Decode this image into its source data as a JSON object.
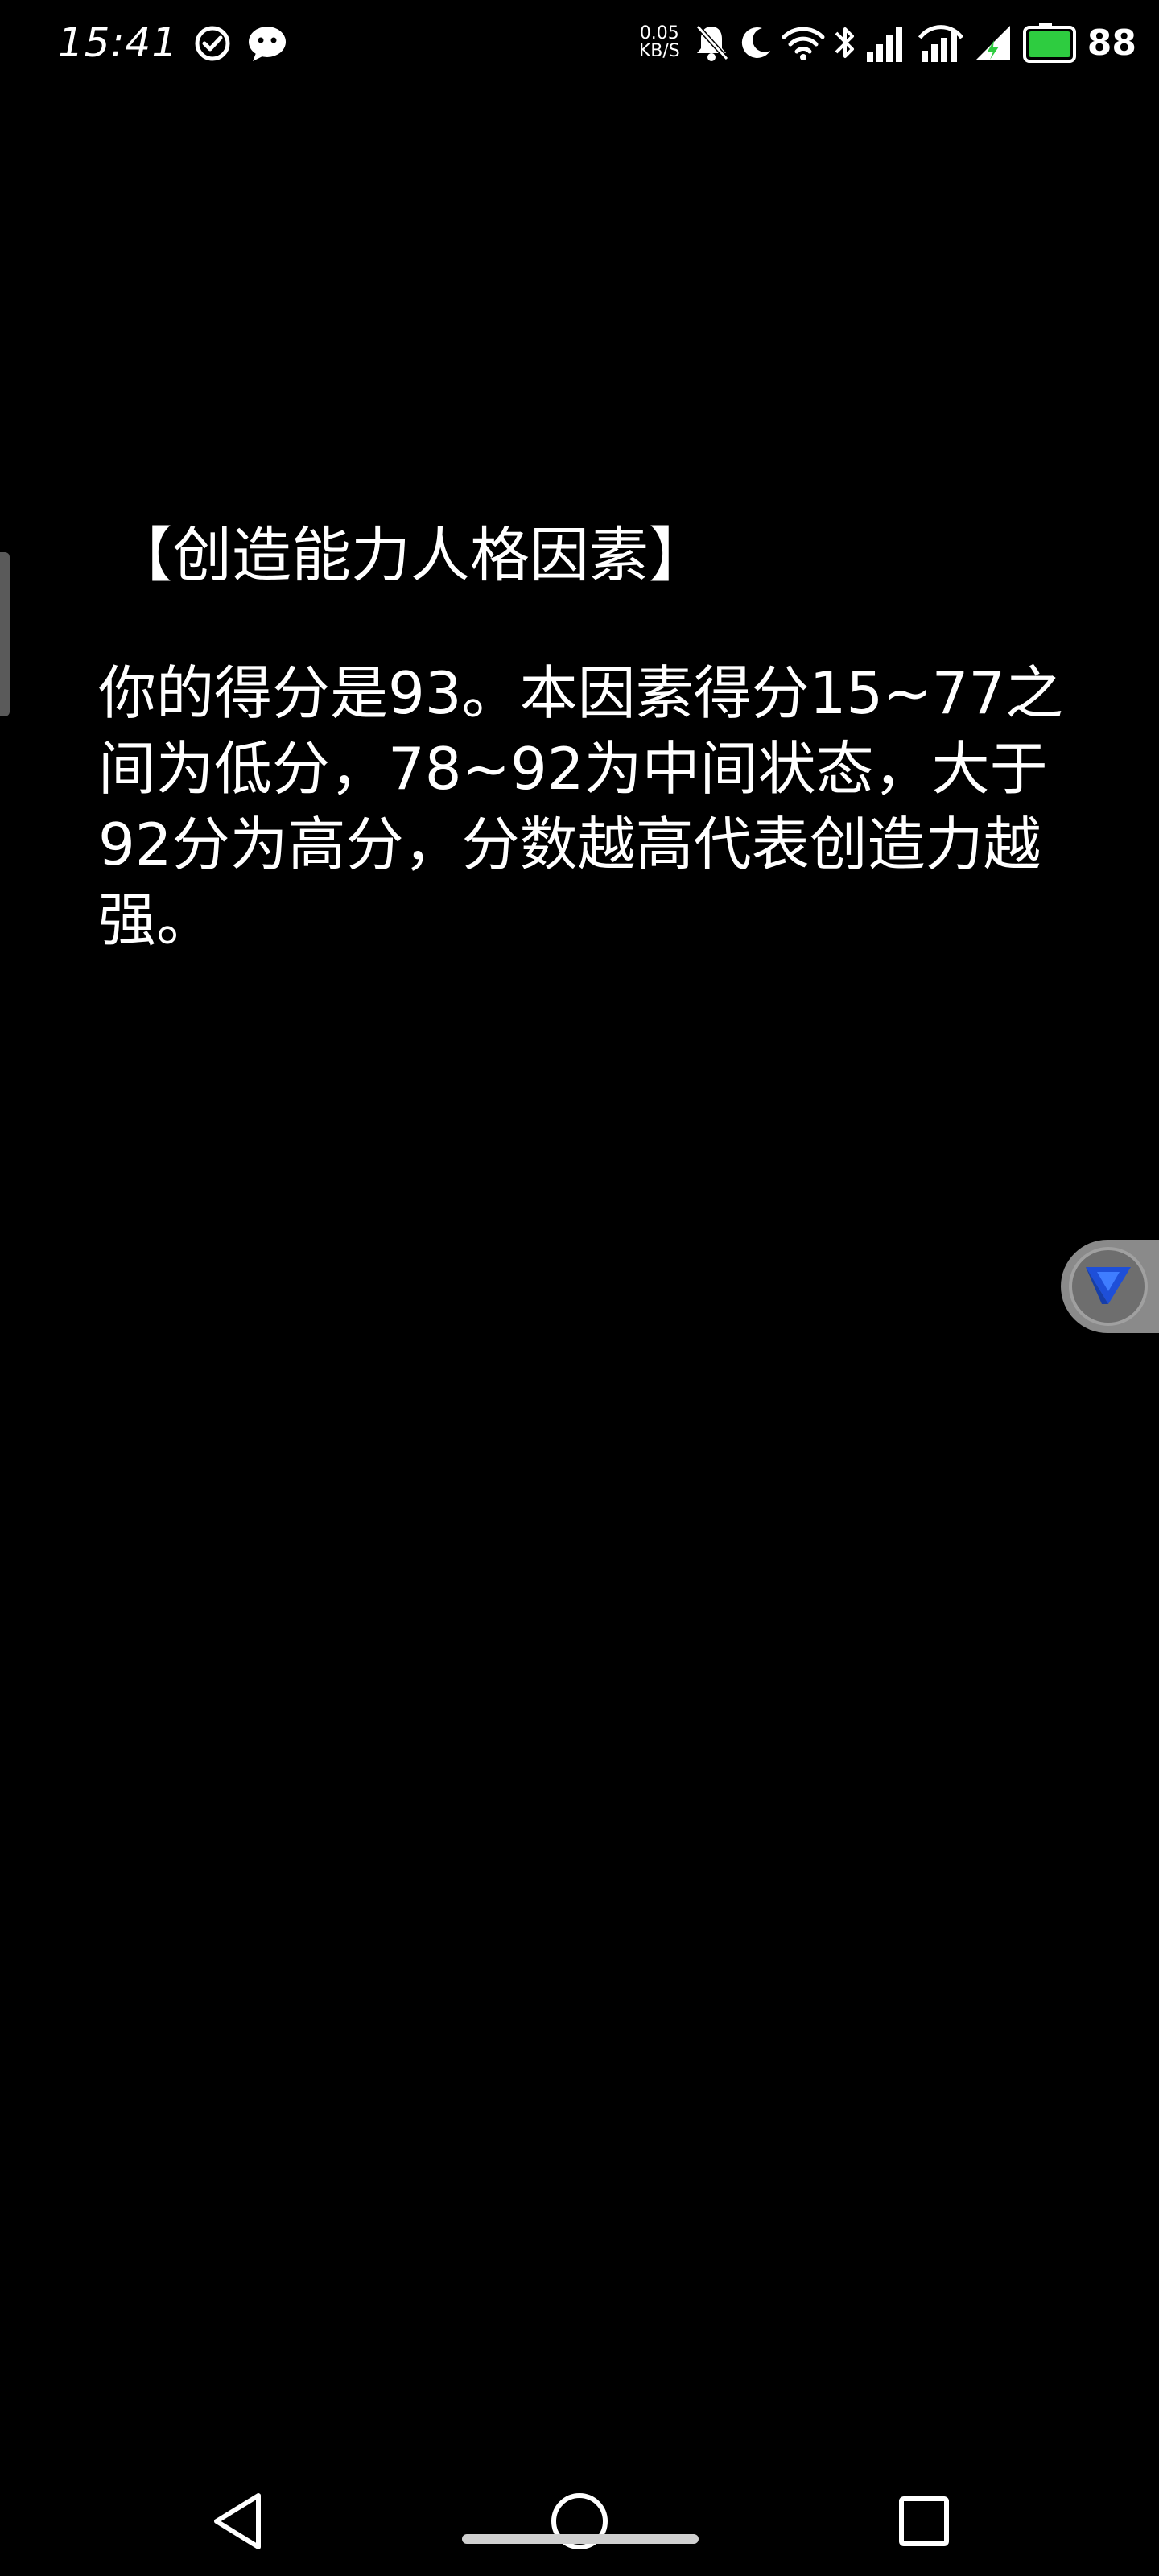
{
  "status_bar": {
    "time": "15:41",
    "net_speed_value": "0.05",
    "net_speed_unit": "KB/S",
    "battery_level": "88",
    "icons": [
      "check-circle-icon",
      "wechat-icon",
      "mute-icon",
      "moon-icon",
      "wifi-icon",
      "bluetooth-icon",
      "signal-icon",
      "battery-icon"
    ]
  },
  "content": {
    "title": "【创造能力人格因素】",
    "body": "你的得分是93。本因素得分15~77之间为低分，78~92为中间状态，大于92分为高分，分数越高代表创造力越强。"
  },
  "float_button": {
    "icon": "v-logo-icon"
  },
  "nav_bar": {
    "back_icon": "back-triangle-icon",
    "home_icon": "home-circle-icon",
    "recents_icon": "recents-square-icon"
  },
  "colors": {
    "background": "#000000",
    "text": "#ffffff",
    "battery_fill": "#2ecc40",
    "float_icon": "#1e4fd8"
  }
}
